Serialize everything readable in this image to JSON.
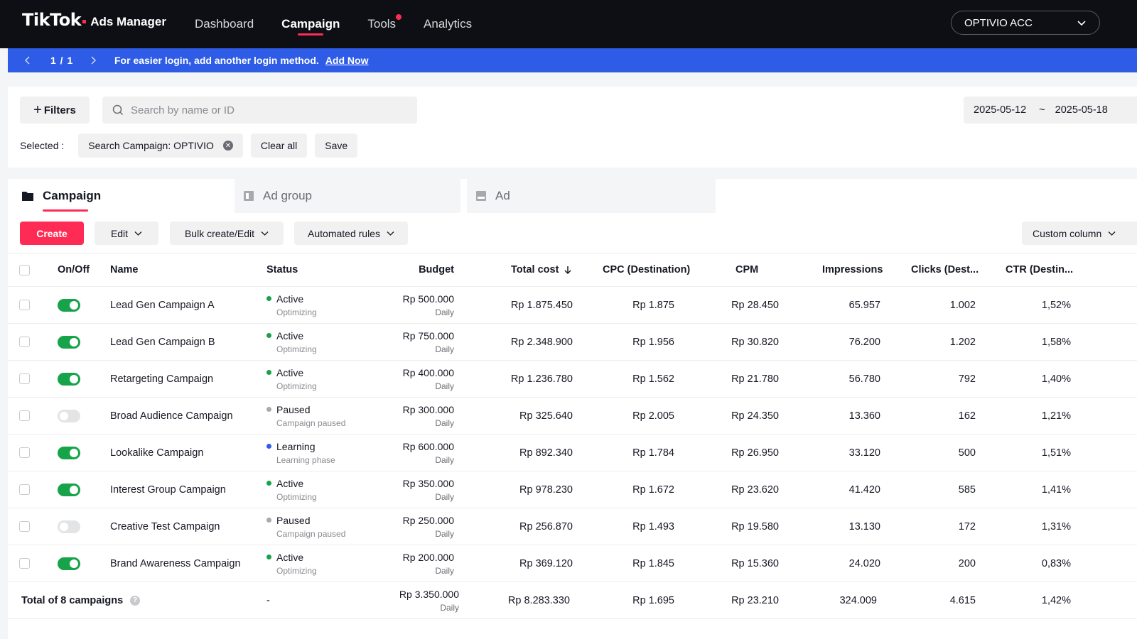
{
  "app": {
    "logo_brand": "TikTok",
    "logo_product": "Ads Manager",
    "nav": [
      {
        "label": "Dashboard"
      },
      {
        "label": "Campaign"
      },
      {
        "label": "Tools"
      },
      {
        "label": "Analytics"
      }
    ],
    "active_nav": "Campaign",
    "account": "OPTIVIO ACC",
    "accent_color": "#fe2c55"
  },
  "banner": {
    "pager": "1 / 1",
    "message": "For easier login, add another login method.",
    "link": "Add Now",
    "color": "#2e5ce6"
  },
  "filters": {
    "filters_button": "Filters",
    "search_placeholder": "Search by name or ID",
    "date_start": "2025-05-12",
    "date_separator": "~",
    "date_end": "2025-05-18",
    "selected_label": "Selected :",
    "chip": "Search Campaign: OPTIVIO",
    "clear_all": "Clear all",
    "save": "Save"
  },
  "tabs": [
    {
      "label": "Campaign",
      "icon": "folder-icon"
    },
    {
      "label": "Ad group",
      "icon": "adgroup-icon"
    },
    {
      "label": "Ad",
      "icon": "ad-icon"
    }
  ],
  "toolbar": {
    "create": "Create",
    "edit": "Edit",
    "bulk": "Bulk create/Edit",
    "rules": "Automated rules",
    "custom_column": "Custom column"
  },
  "table": {
    "headers": {
      "onoff": "On/Off",
      "name": "Name",
      "status": "Status",
      "budget": "Budget",
      "total_cost": "Total cost",
      "cpc": "CPC (Destination)",
      "cpm": "CPM",
      "impressions": "Impressions",
      "clicks": "Clicks (Dest...",
      "ctr": "CTR (Destin..."
    },
    "rows": [
      {
        "on": true,
        "name": "Lead Gen Campaign A",
        "status": "Active",
        "status_sub": "Optimizing",
        "status_color": "#17a34a",
        "budget": "Rp 500.000",
        "budget_sub": "Daily",
        "total_cost": "Rp 1.875.450",
        "cpc": "Rp 1.875",
        "cpm": "Rp 28.450",
        "impressions": "65.957",
        "clicks": "1.002",
        "ctr": "1,52%"
      },
      {
        "on": true,
        "name": "Lead Gen Campaign B",
        "status": "Active",
        "status_sub": "Optimizing",
        "status_color": "#17a34a",
        "budget": "Rp 750.000",
        "budget_sub": "Daily",
        "total_cost": "Rp 2.348.900",
        "cpc": "Rp 1.956",
        "cpm": "Rp 30.820",
        "impressions": "76.200",
        "clicks": "1.202",
        "ctr": "1,58%"
      },
      {
        "on": true,
        "name": "Retargeting Campaign",
        "status": "Active",
        "status_sub": "Optimizing",
        "status_color": "#17a34a",
        "budget": "Rp 400.000",
        "budget_sub": "Daily",
        "total_cost": "Rp 1.236.780",
        "cpc": "Rp 1.562",
        "cpm": "Rp 21.780",
        "impressions": "56.780",
        "clicks": "792",
        "ctr": "1,40%"
      },
      {
        "on": false,
        "name": "Broad Audience Campaign",
        "status": "Paused",
        "status_sub": "Campaign paused",
        "status_color": "#a8a9ad",
        "budget": "Rp 300.000",
        "budget_sub": "Daily",
        "total_cost": "Rp 325.640",
        "cpc": "Rp 2.005",
        "cpm": "Rp 24.350",
        "impressions": "13.360",
        "clicks": "162",
        "ctr": "1,21%"
      },
      {
        "on": true,
        "name": "Lookalike Campaign",
        "status": "Learning",
        "status_sub": "Learning phase",
        "status_color": "#2e5ce6",
        "budget": "Rp 600.000",
        "budget_sub": "Daily",
        "total_cost": "Rp 892.340",
        "cpc": "Rp 1.784",
        "cpm": "Rp 26.950",
        "impressions": "33.120",
        "clicks": "500",
        "ctr": "1,51%"
      },
      {
        "on": true,
        "name": "Interest Group Campaign",
        "status": "Active",
        "status_sub": "Optimizing",
        "status_color": "#17a34a",
        "budget": "Rp 350.000",
        "budget_sub": "Daily",
        "total_cost": "Rp 978.230",
        "cpc": "Rp 1.672",
        "cpm": "Rp 23.620",
        "impressions": "41.420",
        "clicks": "585",
        "ctr": "1,41%"
      },
      {
        "on": false,
        "name": "Creative Test Campaign",
        "status": "Paused",
        "status_sub": "Campaign paused",
        "status_color": "#a8a9ad",
        "budget": "Rp 250.000",
        "budget_sub": "Daily",
        "total_cost": "Rp 256.870",
        "cpc": "Rp 1.493",
        "cpm": "Rp 19.580",
        "impressions": "13.130",
        "clicks": "172",
        "ctr": "1,31%"
      },
      {
        "on": true,
        "name": "Brand Awareness Campaign",
        "status": "Active",
        "status_sub": "Optimizing",
        "status_color": "#17a34a",
        "budget": "Rp 200.000",
        "budget_sub": "Daily",
        "total_cost": "Rp 369.120",
        "cpc": "Rp 1.845",
        "cpm": "Rp 15.360",
        "impressions": "24.020",
        "clicks": "200",
        "ctr": "0,83%"
      }
    ],
    "total": {
      "label": "Total of 8 campaigns",
      "status": "-",
      "budget": "Rp 3.350.000",
      "budget_sub": "Daily",
      "total_cost": "Rp 8.283.330",
      "cpc": "Rp 1.695",
      "cpm": "Rp 23.210",
      "impressions": "324.009",
      "clicks": "4.615",
      "ctr": "1,42%"
    }
  }
}
